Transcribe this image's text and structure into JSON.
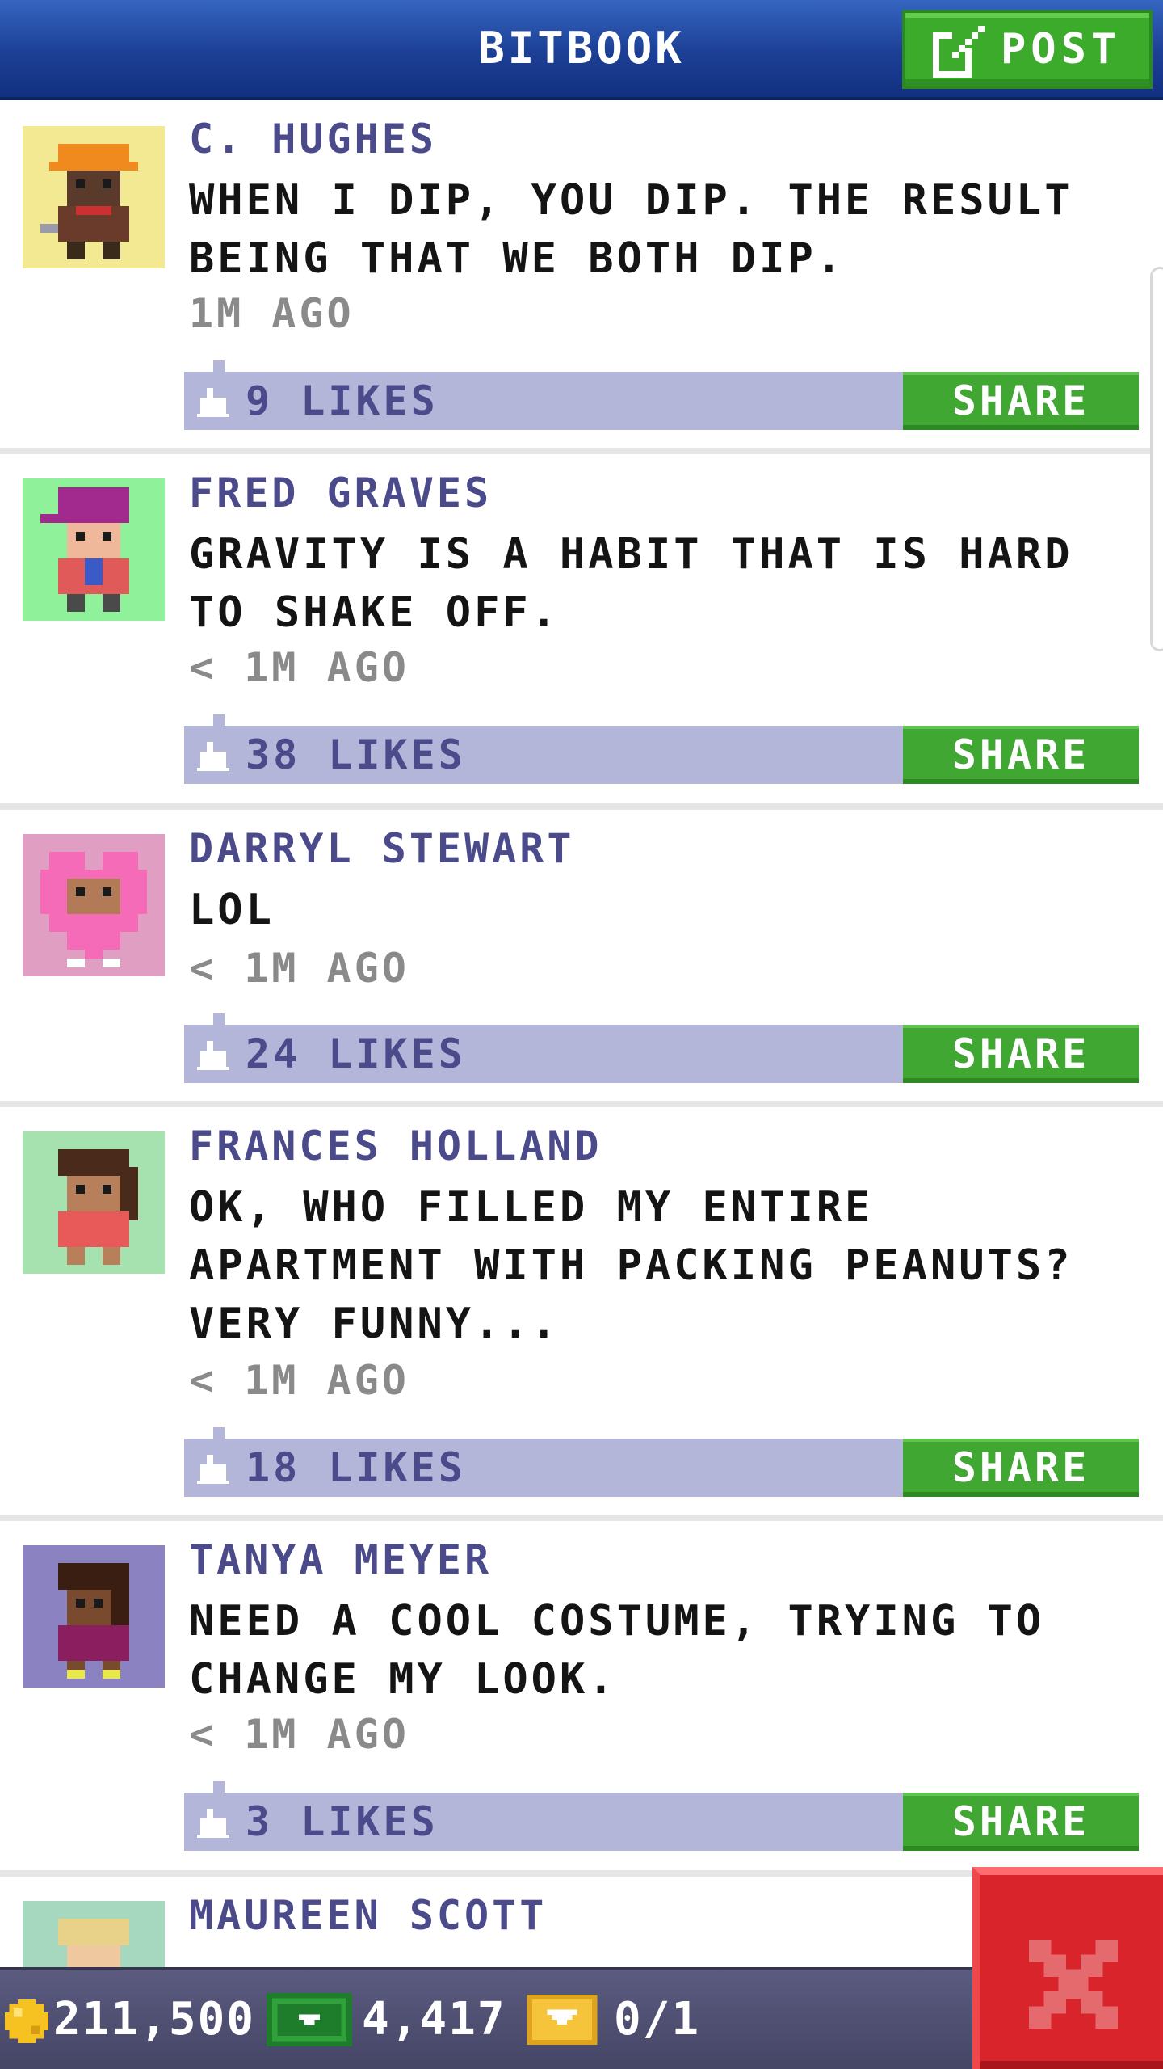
{
  "header": {
    "title": "BITBOOK",
    "post_label": "POST"
  },
  "posts": [
    {
      "author": "C. HUGHES",
      "message": "WHEN I DIP, YOU DIP. THE RESULT BEING THAT WE BOTH DIP.",
      "time": "1M AGO",
      "likes": "9 LIKES",
      "share_label": "SHARE",
      "avatar_bg": "#f3e993"
    },
    {
      "author": "FRED GRAVES",
      "message": "GRAVITY IS A HABIT THAT IS HARD TO SHAKE OFF.",
      "time": "< 1M AGO",
      "likes": "38 LIKES",
      "share_label": "SHARE",
      "avatar_bg": "#8ff29a"
    },
    {
      "author": "DARRYL STEWART",
      "message": "LOL",
      "time": "< 1M AGO",
      "likes": "24 LIKES",
      "share_label": "SHARE",
      "avatar_bg": "#e09ec3"
    },
    {
      "author": "FRANCES HOLLAND",
      "message": "OK, WHO FILLED MY ENTIRE APARTMENT WITH PACKING PEANUTS? VERY FUNNY...",
      "time": "< 1M AGO",
      "likes": "18 LIKES",
      "share_label": "SHARE",
      "avatar_bg": "#a6e2b0"
    },
    {
      "author": "TANYA MEYER",
      "message": "NEED A COOL COSTUME, TRYING TO CHANGE MY LOOK.",
      "time": "< 1M AGO",
      "likes": "3 LIKES",
      "share_label": "SHARE",
      "avatar_bg": "#8b83c1"
    },
    {
      "author": "MAUREEN SCOTT",
      "avatar_bg": "#a6d8c0"
    }
  ],
  "status_bar": {
    "coins": "211,500",
    "bux": "4,417",
    "tickets": "0/1"
  },
  "icons": {
    "post": "edit-icon",
    "like": "thumbs-up-icon",
    "coin": "coin-icon",
    "bux": "bux-icon",
    "ticket": "ticket-icon",
    "close": "close-icon"
  },
  "colors": {
    "header_blue": "#1c3f95",
    "accent_green": "#3fa732",
    "name_purple": "#4b4a8b",
    "like_bar": "#b4b6d9",
    "close_red": "#d9242b"
  }
}
